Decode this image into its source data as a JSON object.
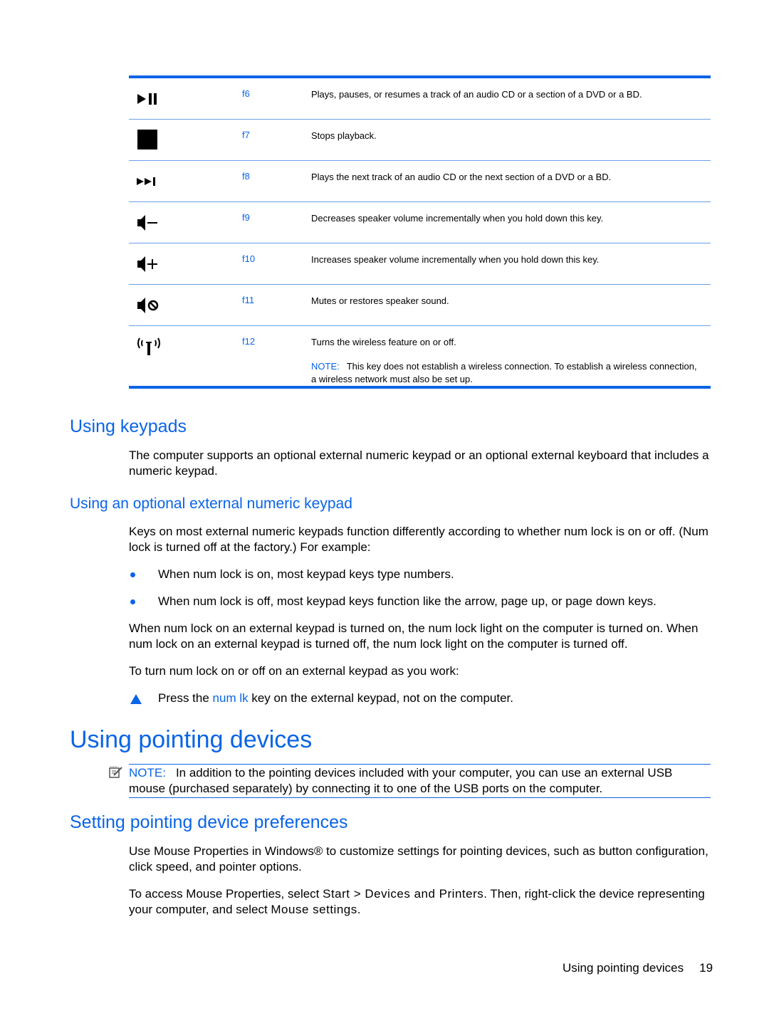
{
  "key_table": {
    "rows": [
      {
        "icon": "play-pause-icon",
        "key": "f6",
        "description": "Plays, pauses, or resumes a track of an audio CD or a section of a DVD or a BD."
      },
      {
        "icon": "stop-icon",
        "key": "f7",
        "description": "Stops playback."
      },
      {
        "icon": "next-track-icon",
        "key": "f8",
        "description": "Plays the next track of an audio CD or the next section of a DVD or a BD."
      },
      {
        "icon": "volume-down-icon",
        "key": "f9",
        "description": "Decreases speaker volume incrementally when you hold down this key."
      },
      {
        "icon": "volume-up-icon",
        "key": "f10",
        "description": "Increases speaker volume incrementally when you hold down this key."
      },
      {
        "icon": "mute-icon",
        "key": "f11",
        "description": "Mutes or restores speaker sound."
      },
      {
        "icon": "wireless-icon",
        "key": "f12",
        "description": "Turns the wireless feature on or off.",
        "note_label": "NOTE:",
        "note_text": "This key does not establish a wireless connection. To establish a wireless connection, a wireless network must also be set up."
      }
    ]
  },
  "using_keypads": {
    "heading": "Using keypads",
    "para": "The computer supports an optional external numeric keypad or an optional external keyboard that includes a numeric keypad."
  },
  "external_keypad": {
    "heading": "Using an optional external numeric keypad",
    "intro": "Keys on most external numeric keypads function differently according to whether num lock is on or off. (Num lock is turned off at the factory.) For example:",
    "bullets": [
      "When num lock is on, most keypad keys type numbers.",
      "When num lock is off, most keypad keys function like the arrow, page up, or page down keys."
    ],
    "para2": "When num lock on an external keypad is turned on, the num lock light on the computer is turned on. When num lock on an external keypad is turned off, the num lock light on the computer is turned off.",
    "para3": "To turn num lock on or off on an external keypad as you work:",
    "step_pre": "Press the ",
    "step_key": "num lk",
    "step_post": " key on the external keypad, not on the computer."
  },
  "pointing_devices": {
    "heading": "Using pointing devices",
    "note_label": "NOTE:",
    "note_text": "In addition to the pointing devices included with your computer, you can use an external USB mouse (purchased separately) by connecting it to one of the USB ports on the computer."
  },
  "preferences": {
    "heading": "Setting pointing device preferences",
    "para1": "Use Mouse Properties in Windows® to customize settings for pointing devices, such as button configuration, click speed, and pointer options.",
    "para2_pre": "To access Mouse Properties, select ",
    "para2_path": "Start > Devices and Printers",
    "para2_mid": ". Then, right-click the device representing your computer, and select ",
    "para2_item": "Mouse settings",
    "para2_post": "."
  },
  "footer": {
    "section": "Using pointing devices",
    "page": "19"
  },
  "colors": {
    "accent": "#0a64e6",
    "text": "#000000"
  }
}
